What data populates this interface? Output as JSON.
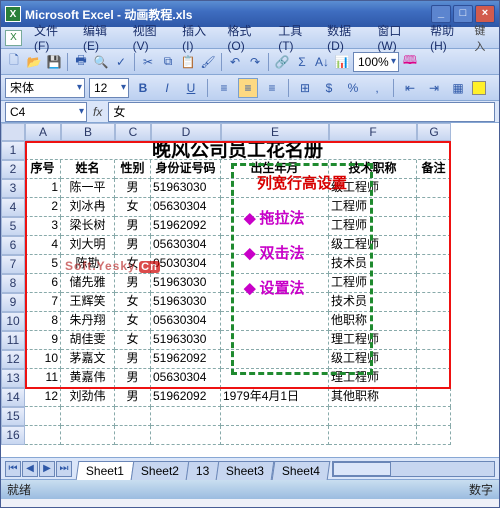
{
  "app": {
    "title": "Microsoft Excel - 动画教程.xls"
  },
  "windowButtons": {
    "min": "_",
    "max": "□",
    "close": "×"
  },
  "menu": {
    "items": [
      "文件(F)",
      "编辑(E)",
      "视图(V)",
      "插入(I)",
      "格式(O)",
      "工具(T)",
      "数据(D)",
      "窗口(W)",
      "帮助(H)"
    ],
    "helpPrompt": "键入"
  },
  "toolbar1": {
    "icons": [
      "new-file",
      "open-file",
      "save",
      "permission",
      "print",
      "preview",
      "spelling",
      "cut",
      "copy",
      "paste",
      "format-paint",
      "undo",
      "redo",
      "hyperlink",
      "autosum",
      "sort-asc",
      "chart",
      "zoom"
    ],
    "zoom": "100%"
  },
  "format": {
    "fontName": "宋体",
    "fontSize": "12",
    "buttons": [
      "B",
      "I",
      "U"
    ],
    "align": [
      "≡",
      "≡",
      "≡"
    ],
    "fill": "#fff02a"
  },
  "nameBox": "C4",
  "formulaBar": "女",
  "columns": [
    {
      "letter": "A",
      "w": 36
    },
    {
      "letter": "B",
      "w": 54
    },
    {
      "letter": "C",
      "w": 36
    },
    {
      "letter": "D",
      "w": 70
    },
    {
      "letter": "E",
      "w": 108
    },
    {
      "letter": "F",
      "w": 88
    },
    {
      "letter": "G",
      "w": 34
    }
  ],
  "titleRow": "晚风公司员工花名册",
  "headers": [
    "序号",
    "姓名",
    "性别",
    "身份证号码",
    "出生年月",
    "技术职称",
    "备注"
  ],
  "data": [
    [
      "1",
      "陈一平",
      "男",
      "51963030",
      "",
      "级工程师",
      ""
    ],
    [
      "2",
      "刘冰冉",
      "女",
      "05630304",
      "",
      "工程师",
      ""
    ],
    [
      "3",
      "梁长树",
      "男",
      "51962092",
      "",
      "工程师",
      ""
    ],
    [
      "4",
      "刘大明",
      "男",
      "05630304",
      "",
      "级工程师",
      ""
    ],
    [
      "5",
      "陈勘",
      "女",
      "05030304",
      "",
      "技术员",
      ""
    ],
    [
      "6",
      "储先雅",
      "男",
      "51963030",
      "",
      "工程师",
      ""
    ],
    [
      "7",
      "王辉笑",
      "女",
      "51963030",
      "",
      "技术员",
      ""
    ],
    [
      "8",
      "朱丹翔",
      "女",
      "05630304",
      "",
      "他职称",
      ""
    ],
    [
      "9",
      "胡佳雯",
      "女",
      "51963030",
      "",
      "理工程师",
      ""
    ],
    [
      "10",
      "茅嘉文",
      "男",
      "51962092",
      "",
      "级工程师",
      ""
    ],
    [
      "11",
      "黄嘉伟",
      "男",
      "05630304",
      "",
      "理工程师",
      ""
    ],
    [
      "12",
      "刘劲伟",
      "男",
      "51962092",
      "1979年4月1日",
      "其他职称",
      ""
    ]
  ],
  "overlay": {
    "title": "列宽行高设置",
    "items": [
      "拖拉法",
      "双击法",
      "设置法"
    ]
  },
  "tabs": [
    "Sheet1",
    "Sheet2",
    "13",
    "Sheet3",
    "Sheet4"
  ],
  "activeTab": 0,
  "status": {
    "left": "就绪",
    "right": "数字"
  },
  "watermark": {
    "t1": "Soft.Yesky.",
    "t2": "Cn"
  }
}
